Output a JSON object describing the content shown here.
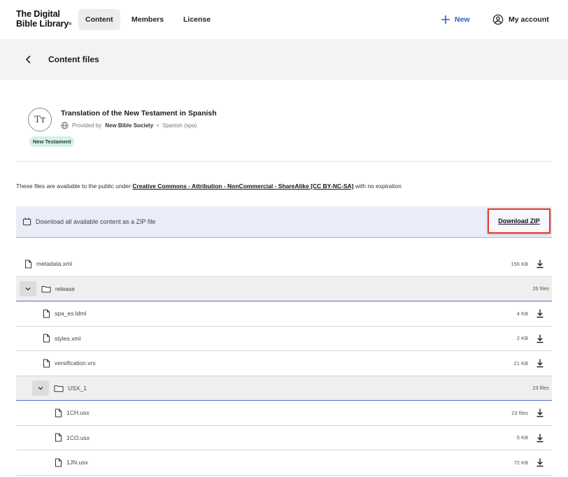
{
  "brand": {
    "line1": "The Digital",
    "line2": "Bible Library",
    "mark": "®"
  },
  "nav": {
    "tabs": [
      "Content",
      "Members",
      "License"
    ],
    "new_label": "New",
    "account_label": "My account"
  },
  "subheader": {
    "title": "Content files"
  },
  "publication": {
    "avatar": "Tт",
    "title": "Translation of the New Testament in Spanish",
    "provided_by_prefix": "Provided by",
    "provider": "New Bible Society",
    "separator": "•",
    "language": "Spanish (spa)",
    "badge": "New Testament"
  },
  "license": {
    "prefix": "These files are available to the public under",
    "link": "Creative Commons - Attribution - NonCommercial - ShareAlike [CC BY-NC-SA]",
    "suffix": "with no expiration"
  },
  "download": {
    "description": "Download all available content as a ZIP file",
    "button": "Download ZIP"
  },
  "files": [
    {
      "type": "file",
      "name": "metadata.xml",
      "size": "156 KB",
      "indent": 0
    },
    {
      "type": "folder",
      "name": "release",
      "size": "26 files",
      "indent": 0
    },
    {
      "type": "file",
      "name": "spa_es.ldml",
      "size": "4 KB",
      "indent": 1
    },
    {
      "type": "file",
      "name": "styles.xml",
      "size": "2 KB",
      "indent": 1
    },
    {
      "type": "file",
      "name": "versification.vrs",
      "size": "21 KB",
      "indent": 1
    },
    {
      "type": "folder",
      "name": "USX_1",
      "size": "23 files",
      "indent": 1
    },
    {
      "type": "file",
      "name": "1CH.usx",
      "size": "23 files",
      "indent": 2
    },
    {
      "type": "file",
      "name": "1CO.usx",
      "size": "5 KB",
      "indent": 2
    },
    {
      "type": "file",
      "name": "1JN.usx",
      "size": "72 KB",
      "indent": 2
    }
  ],
  "colors": {
    "accent": "#2f5bd3",
    "highlight": "#e8392b",
    "badge_bg": "#d6efe8"
  }
}
